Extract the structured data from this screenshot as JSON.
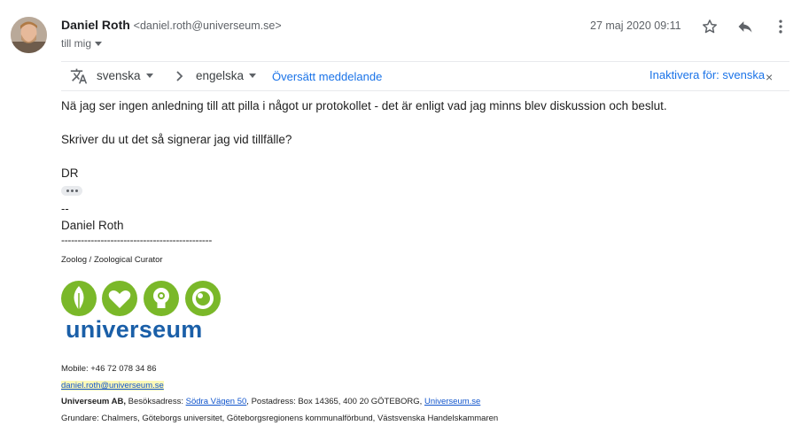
{
  "header": {
    "sender_name": "Daniel Roth",
    "sender_email": "<daniel.roth@universeum.se>",
    "recipient_label": "till mig",
    "date": "27 maj 2020 09:11"
  },
  "translate_bar": {
    "source_language": "svenska",
    "target_language": "engelska",
    "translate_label": "Översätt meddelande",
    "disable_label": "Inaktivera för: svenska",
    "close_symbol": "×"
  },
  "message": {
    "line1": "Nä jag ser ingen anledning till att pilla i något ur protokollet - det är enligt vad jag minns blev diskussion och beslut.",
    "line2": "Skriver du ut det så signerar jag vid tillfälle?",
    "initials": "DR"
  },
  "signature": {
    "dashes": "--",
    "name": "Daniel Roth",
    "separator": "----------------------------------------------",
    "title": "Zoolog / Zoological Curator",
    "logo_text": "universeum",
    "mobile": "Mobile: +46 72 078 34 86",
    "email_link": "daniel.roth@universeum.se",
    "company": "Universeum AB,",
    "visit_label": "Besöksadress:",
    "visit_link": "Södra Vägen 50",
    "postal": ", Postadress: Box 14365, 400 20 GÖTEBORG,",
    "site_link": "Universeum.se",
    "founders": "Grundare: Chalmers, Göteborgs universitet, Göteborgsregionens kommunalförbund, Västsvenska Handelskammaren"
  },
  "colors": {
    "accent": "#1a73e8",
    "logo_green": "#7ab829",
    "logo_blue": "#1a5fa8"
  }
}
